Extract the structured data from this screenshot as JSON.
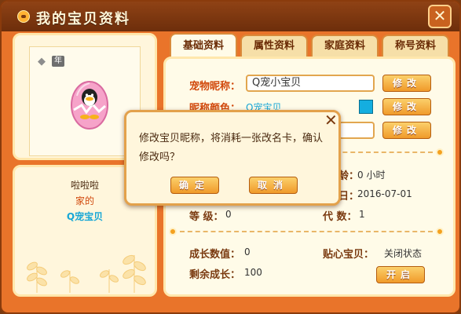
{
  "window": {
    "title": "我的宝贝资料",
    "close_symbol": "✕"
  },
  "colors": {
    "accent": "#e9742a",
    "label_red": "#d1480b",
    "button": "#f09a2a",
    "swatch": "#14aee0"
  },
  "left": {
    "year_badge": "年",
    "diamond_icon": "diamond-icon",
    "name": "啦啦啦",
    "family": "家的",
    "nickname": "Q宠宝贝"
  },
  "tabs": [
    {
      "label": "基础资料",
      "active": true
    },
    {
      "label": "属性资料",
      "active": false
    },
    {
      "label": "家庭资料",
      "active": false
    },
    {
      "label": "称号资料",
      "active": false
    }
  ],
  "basic": {
    "nickname_label": "宠物昵称：",
    "nickname_value": "Q宠小宝贝",
    "nickname_button": "修改",
    "color_label": "昵称颜色：",
    "color_preview": "Q宠宝贝",
    "color_button": "修改",
    "third_button": "修改",
    "age_label": "龄：",
    "age_value": "0 小时",
    "birthday_label": "日：",
    "birthday_value": "2016-07-01",
    "level_label": "等 级：",
    "level_value": "0",
    "generation_label": "代 数：",
    "generation_value": "1",
    "growth_label": "成长数值：",
    "growth_value": "0",
    "caring_label": "贴心宝贝：",
    "caring_value": "关闭状态",
    "remaining_label": "剩余成长：",
    "remaining_value": "100",
    "open_button": "开启"
  },
  "dialog": {
    "message": "修改宝贝昵称，将消耗一张改名卡，确认修改吗？",
    "confirm": "确定",
    "cancel": "取消",
    "close_symbol": "✕"
  }
}
